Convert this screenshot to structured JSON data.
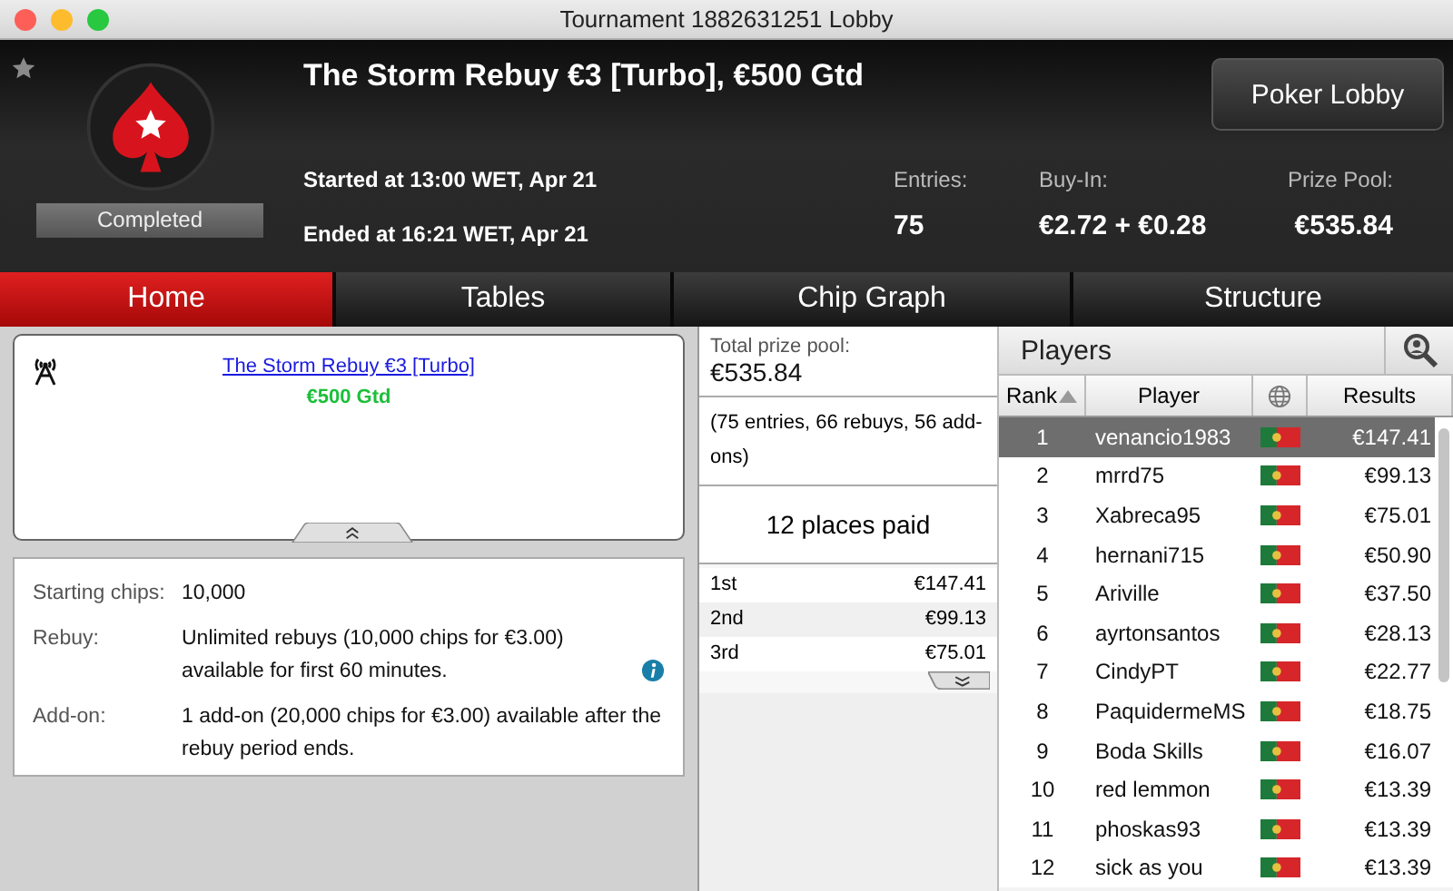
{
  "window": {
    "title": "Tournament 1882631251 Lobby"
  },
  "header": {
    "title": "The Storm Rebuy €3 [Turbo], €500 Gtd",
    "status": "Completed",
    "started": "Started at 13:00 WET, Apr 21",
    "ended": "Ended at 16:21 WET, Apr 21",
    "lobby_button": "Poker Lobby",
    "stats": [
      {
        "label": "Entries:",
        "value": "75"
      },
      {
        "label": "Buy-In:",
        "value": "€2.72 + €0.28"
      },
      {
        "label": "Prize Pool:",
        "value": "€535.84"
      }
    ]
  },
  "tabs": [
    {
      "label": "Home",
      "selected": true
    },
    {
      "label": "Tables",
      "selected": false
    },
    {
      "label": "Chip Graph",
      "selected": false
    },
    {
      "label": "Structure",
      "selected": false
    }
  ],
  "info": {
    "link": "The Storm Rebuy €3 [Turbo]",
    "guarantee": "€500 Gtd",
    "details": [
      {
        "label": "Starting chips:",
        "value": "10,000",
        "info": false
      },
      {
        "label": "Rebuy:",
        "value": "Unlimited rebuys (10,000 chips for €3.00) available for first 60 minutes.",
        "info": true
      },
      {
        "label": "Add-on:",
        "value": "1 add-on (20,000 chips for €3.00) available after the rebuy period ends.",
        "info": false
      }
    ]
  },
  "prizes": {
    "total_label": "Total prize pool:",
    "total": "€535.84",
    "note": "(75 entries, 66 rebuys, 56 add-ons)",
    "places": "12 places paid",
    "payouts": [
      {
        "place": "1st",
        "amount": "€147.41"
      },
      {
        "place": "2nd",
        "amount": "€99.13"
      },
      {
        "place": "3rd",
        "amount": "€75.01"
      }
    ]
  },
  "players": {
    "title": "Players",
    "columns": [
      "Rank",
      "Player",
      "Results"
    ],
    "rows": [
      {
        "rank": "1",
        "name": "venancio1983",
        "result": "€147.41",
        "selected": true
      },
      {
        "rank": "2",
        "name": "mrrd75",
        "result": "€99.13",
        "selected": false
      },
      {
        "rank": "3",
        "name": "Xabreca95",
        "result": "€75.01",
        "selected": false
      },
      {
        "rank": "4",
        "name": "hernani715",
        "result": "€50.90",
        "selected": false
      },
      {
        "rank": "5",
        "name": "Ariville",
        "result": "€37.50",
        "selected": false
      },
      {
        "rank": "6",
        "name": "ayrtonsantos",
        "result": "€28.13",
        "selected": false
      },
      {
        "rank": "7",
        "name": "CindyPT",
        "result": "€22.77",
        "selected": false
      },
      {
        "rank": "8",
        "name": "PaquidermeMS",
        "result": "€18.75",
        "selected": false
      },
      {
        "rank": "9",
        "name": "Boda Skills",
        "result": "€16.07",
        "selected": false
      },
      {
        "rank": "10",
        "name": "red lemmon",
        "result": "€13.39",
        "selected": false
      },
      {
        "rank": "11",
        "name": "phoskas93",
        "result": "€13.39",
        "selected": false
      },
      {
        "rank": "12",
        "name": "sick as you",
        "result": "€13.39",
        "selected": false
      }
    ]
  }
}
